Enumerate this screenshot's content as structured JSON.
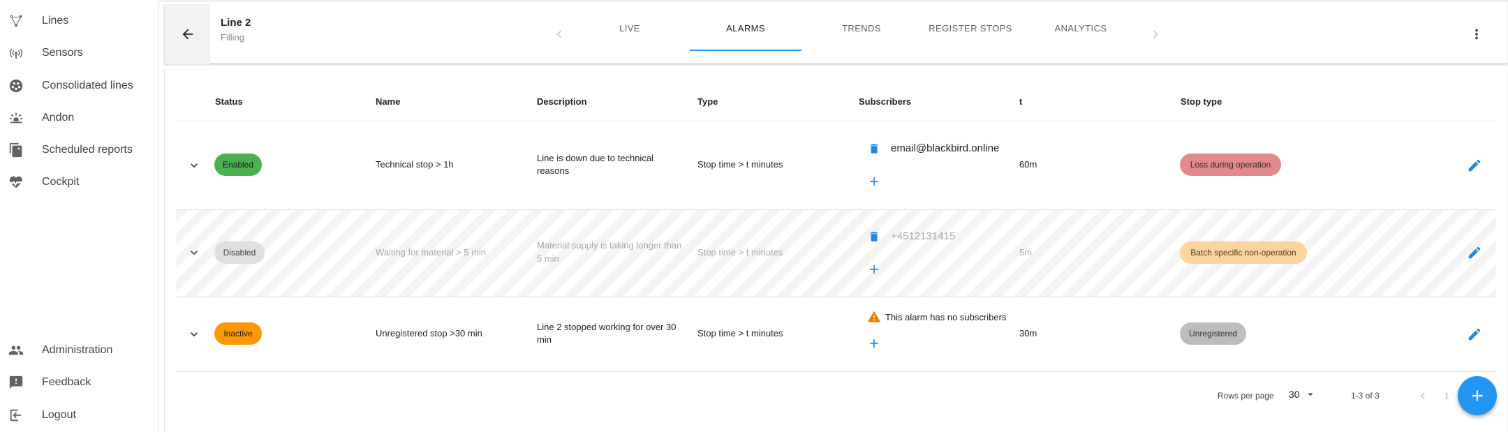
{
  "sidebar": {
    "items": [
      {
        "label": "Lines",
        "icon": "flow-icon"
      },
      {
        "label": "Sensors",
        "icon": "sensor-icon"
      },
      {
        "label": "Consolidated lines",
        "icon": "consolidated-icon"
      },
      {
        "label": "Andon",
        "icon": "andon-icon"
      },
      {
        "label": "Scheduled reports",
        "icon": "reports-icon"
      },
      {
        "label": "Cockpit",
        "icon": "heartbeat-icon"
      }
    ],
    "bottom_items": [
      {
        "label": "Administration",
        "icon": "people-icon"
      },
      {
        "label": "Feedback",
        "icon": "feedback-icon"
      },
      {
        "label": "Logout",
        "icon": "logout-icon"
      }
    ]
  },
  "header": {
    "title": "Line 2",
    "subtitle": "Filling",
    "tabs": [
      {
        "label": "LIVE"
      },
      {
        "label": "ALARMS",
        "active": true
      },
      {
        "label": "TRENDS"
      },
      {
        "label": "REGISTER STOPS"
      },
      {
        "label": "ANALYTICS"
      }
    ]
  },
  "table": {
    "columns": [
      "Status",
      "Name",
      "Description",
      "Type",
      "Subscribers",
      "t",
      "Stop type"
    ],
    "rows": [
      {
        "status": "Enabled",
        "name": "Technical stop > 1h",
        "description_1": "Line is down due to technical",
        "description_2": "reasons",
        "type": "Stop time > t minutes",
        "subscriber": "email@blackbird.online",
        "t": "60m",
        "stop_type": "Loss during operation"
      },
      {
        "status": "Disabled",
        "name": "Waiting for material > 5 min",
        "description_1": "Material supply is taking longer than",
        "description_2": "5 min",
        "type": "Stop time > t minutes",
        "subscriber": "+4512131415",
        "t": "5m",
        "stop_type": "Batch specific non-operation"
      },
      {
        "status": "Inactive",
        "name": "Unregistered stop >30 min",
        "description_1": "Line 2 stopped working for over 30",
        "description_2": "min",
        "type": "Stop time > t minutes",
        "subscriber_warning": "This alarm has no subscribers",
        "t": "30m",
        "stop_type": "Unregistered"
      }
    ]
  },
  "footer": {
    "rows_per_page_label": "Rows per page",
    "rows_per_page": "30",
    "range": "1-3 of 3",
    "page": "1"
  },
  "colors": {
    "accent": "#2196f3",
    "enabled": "#4caf50",
    "disabled": "#e0e0e0",
    "inactive": "#ff9800",
    "loss_during_operation": "#e57373",
    "batch_specific": "#ffcc80",
    "unregistered": "#bdbdbd"
  }
}
